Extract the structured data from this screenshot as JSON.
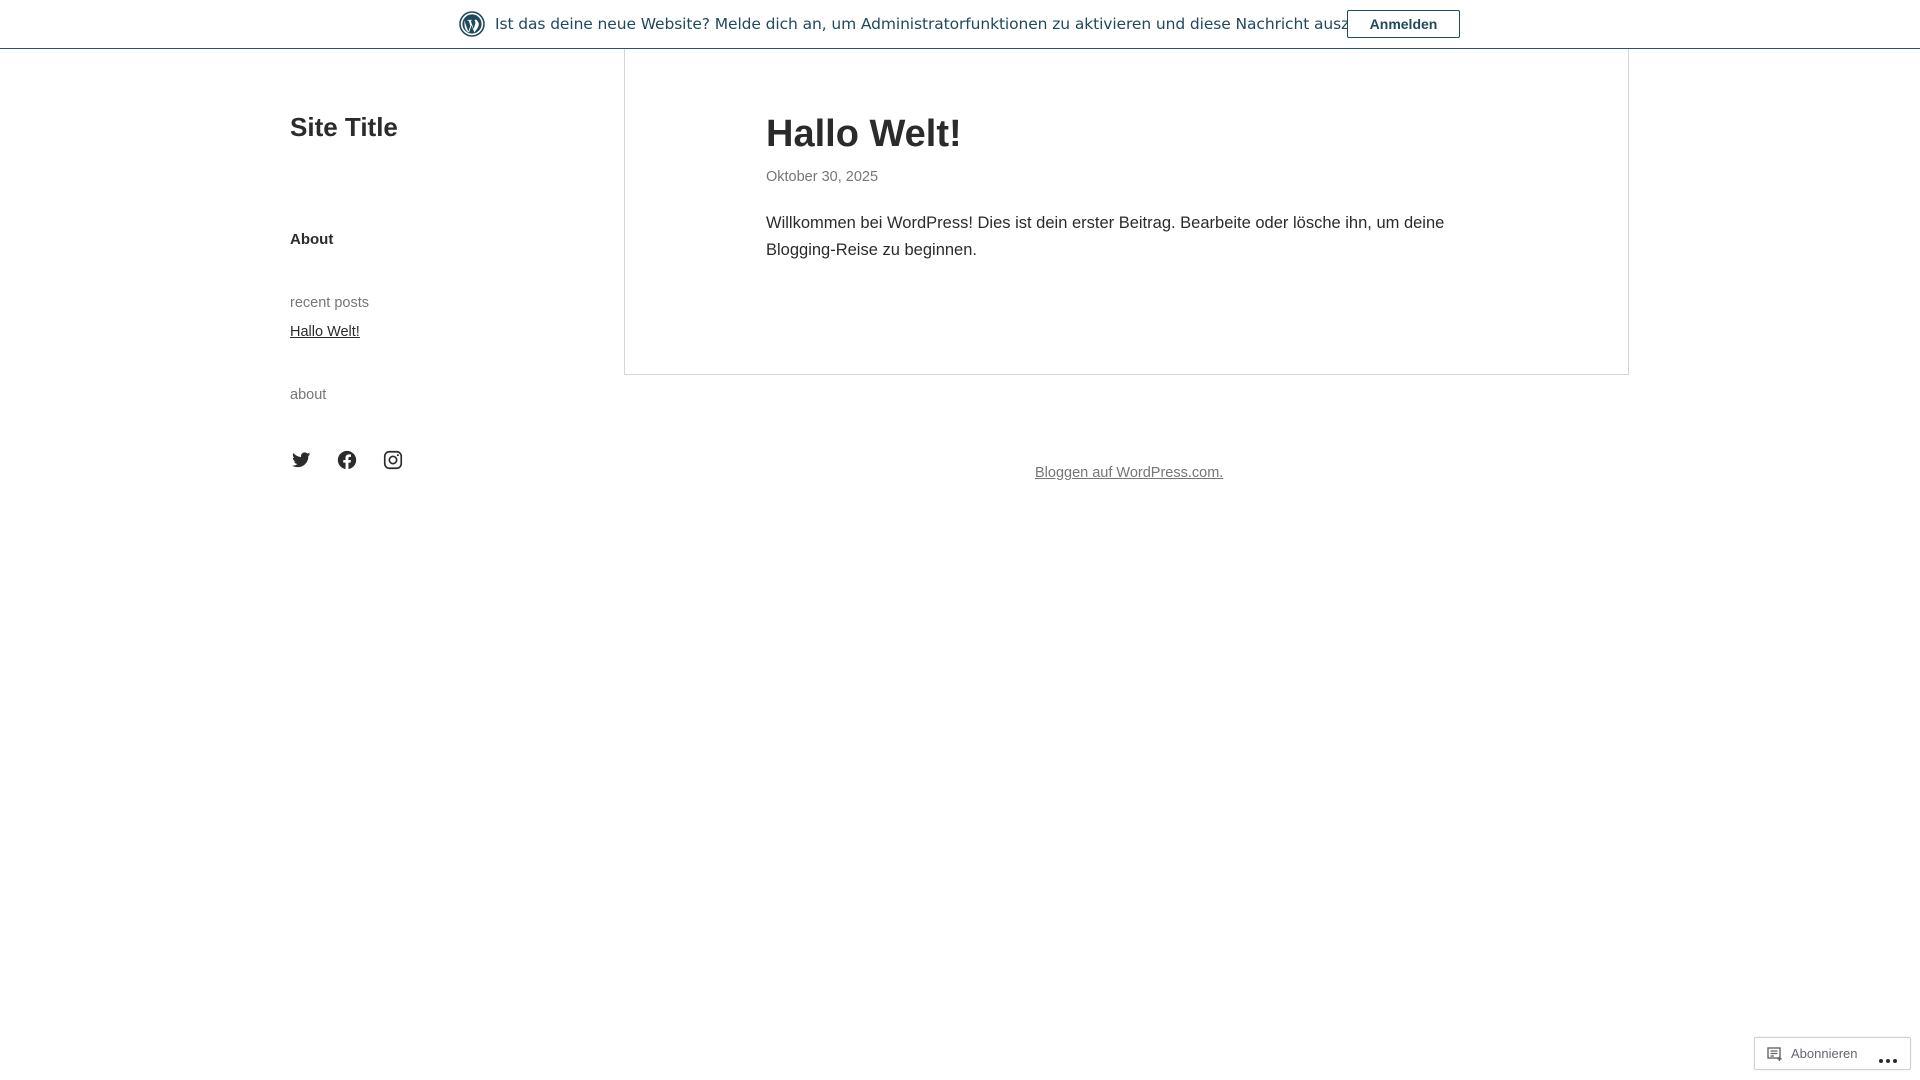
{
  "notice": {
    "text": "Ist das deine neue Website? Melde dich an, um Administratorfunktionen zu aktivieren und diese Nachricht auszublenden.",
    "button_label": "Anmelden",
    "logo_icon": "wordpress-icon",
    "color": "#1f4a5e"
  },
  "sidebar": {
    "site_title": "Site Title",
    "nav_items": [
      {
        "label": "About"
      }
    ],
    "recent_posts": {
      "heading": "recent posts",
      "items": [
        {
          "label": "Hallo Welt!"
        }
      ]
    },
    "about_widget": "about",
    "social_icons": [
      "twitter-icon",
      "facebook-icon",
      "instagram-icon"
    ]
  },
  "post": {
    "title": "Hallo Welt!",
    "date": "Oktober 30, 2025",
    "body": "Willkommen bei WordPress! Dies ist dein erster Beitrag. Bearbeite oder lösche ihn, um deine Blogging-Reise zu beginnen."
  },
  "footer": {
    "link_text": "Bloggen auf WordPress.com."
  },
  "subscribe_bar": {
    "label": "Abonnieren",
    "icon": "reader-icon",
    "more_icon": "ellipsis-icon"
  }
}
